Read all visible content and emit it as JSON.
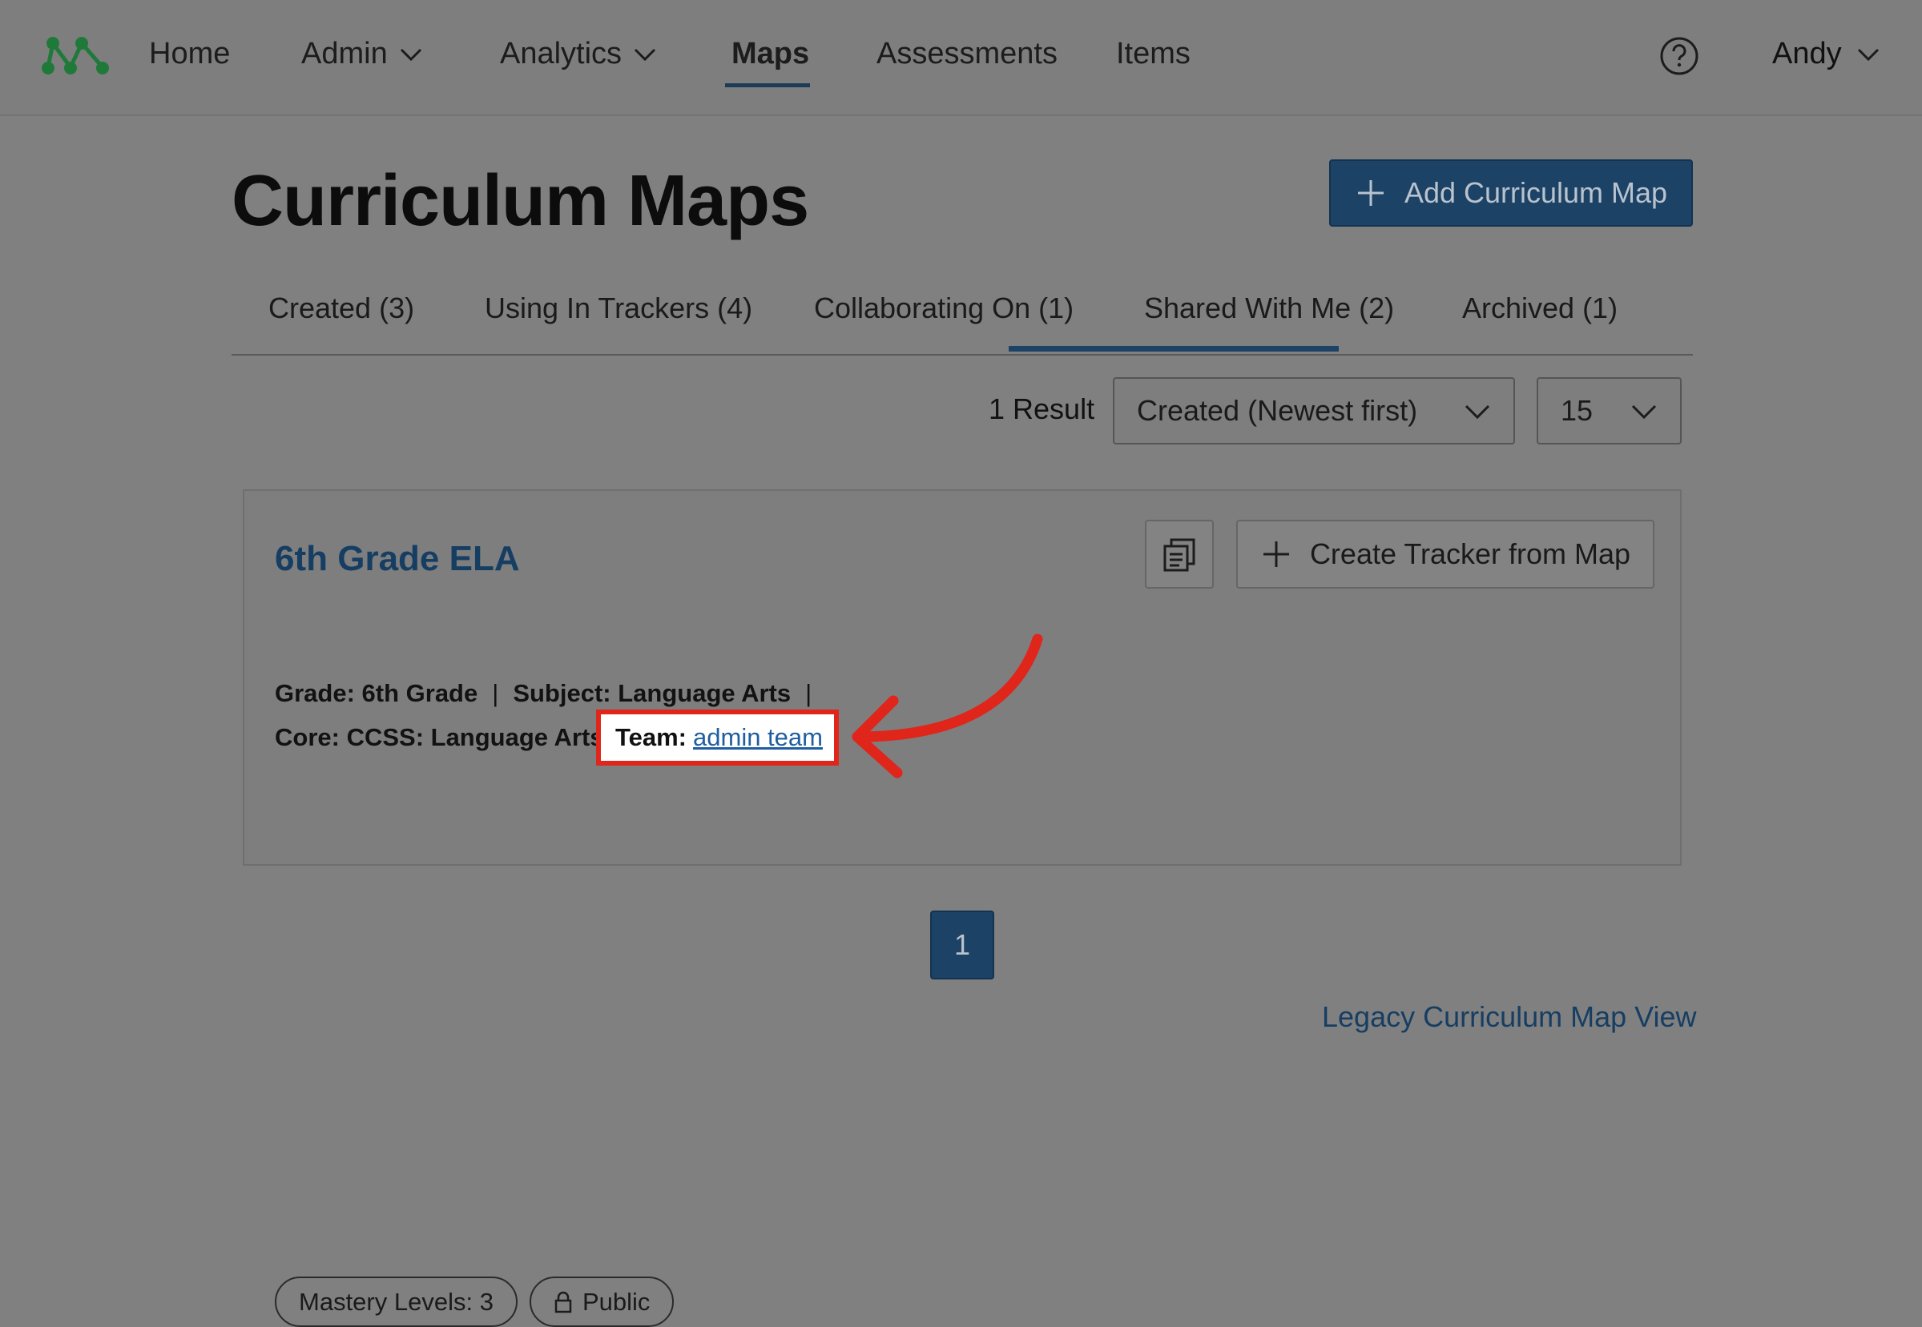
{
  "nav": {
    "home": "Home",
    "admin": "Admin",
    "analytics": "Analytics",
    "maps": "Maps",
    "assessments": "Assessments",
    "items": "Items",
    "user": "Andy"
  },
  "header": {
    "title": "Curriculum Maps",
    "add_button": "Add Curriculum Map"
  },
  "tabs": [
    {
      "label": "Created (3)"
    },
    {
      "label": "Using In Trackers (4)"
    },
    {
      "label": "Collaborating On (1)",
      "active": true
    },
    {
      "label": "Shared With Me (2)"
    },
    {
      "label": "Archived (1)"
    }
  ],
  "controls": {
    "result_count": "1 Result",
    "sort_selected": "Created (Newest first)",
    "per_page_selected": "15"
  },
  "card": {
    "title": "6th Grade ELA",
    "create_tracker_label": "Create Tracker from Map",
    "grade": "Grade: 6th Grade",
    "subject": "Subject: Language Arts",
    "core": "Core: CCSS: Language Arts",
    "team_label": "Team:",
    "team_link": "admin team",
    "mastery_levels": "Mastery Levels: 3",
    "visibility": "Public"
  },
  "pagination": {
    "current_page": "1"
  },
  "footer": {
    "legacy_link": "Legacy Curriculum Map View"
  },
  "colors": {
    "primary": "#1c4266",
    "link": "#163e63",
    "annotation": "#e0251b",
    "logo": "#1f7a3a"
  },
  "icons": [
    "logo-icon",
    "chevron-down-icon",
    "help-icon",
    "plus-icon",
    "copy-icon",
    "lock-icon",
    "annotation-arrow-icon"
  ]
}
